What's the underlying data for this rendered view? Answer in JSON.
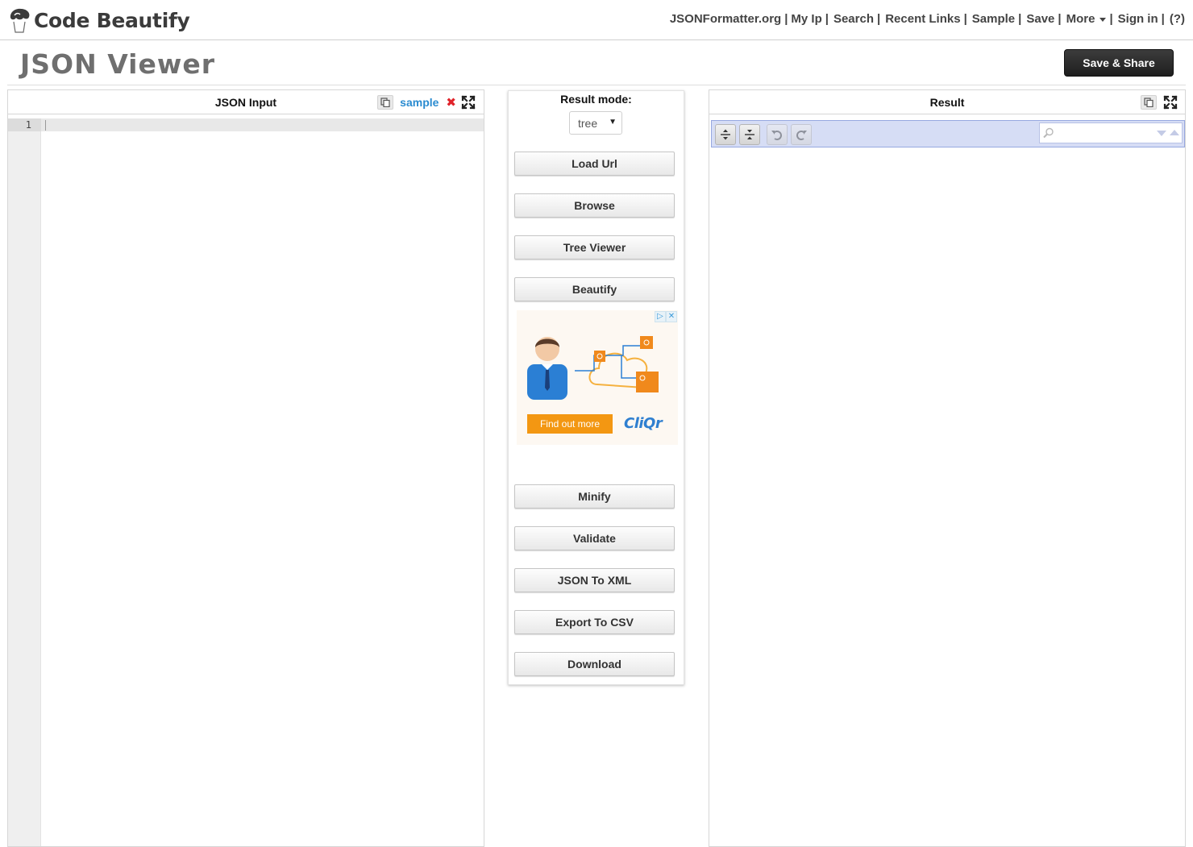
{
  "brand": {
    "name": "Code Beautify"
  },
  "nav": {
    "items": [
      {
        "label": "JSONFormatter.org"
      },
      {
        "label": "My Ip"
      },
      {
        "label": "Search"
      },
      {
        "label": "Recent Links"
      },
      {
        "label": "Sample"
      },
      {
        "label": "Save"
      },
      {
        "label": "More"
      },
      {
        "label": "Sign in"
      },
      {
        "label": "(?)"
      }
    ],
    "separator": "|"
  },
  "page": {
    "title": "JSON Viewer",
    "save_share_label": "Save & Share"
  },
  "input_panel": {
    "title": "JSON Input",
    "sample_label": "sample",
    "clear_glyph": "✖",
    "line_numbers": [
      "1"
    ],
    "content": ""
  },
  "controls": {
    "result_mode_label": "Result mode:",
    "result_mode_value": "tree",
    "buttons": [
      {
        "label": "Load Url"
      },
      {
        "label": "Browse"
      },
      {
        "label": "Tree Viewer"
      },
      {
        "label": "Beautify"
      },
      {
        "label": "Minify"
      },
      {
        "label": "Validate"
      },
      {
        "label": "JSON To XML"
      },
      {
        "label": "Export To CSV"
      },
      {
        "label": "Download"
      }
    ]
  },
  "ad": {
    "cta_label": "Find out more",
    "brand": "CliQr",
    "badge_play": "▷",
    "badge_close": "✕"
  },
  "result_panel": {
    "title": "Result",
    "search": {
      "placeholder": "",
      "value": ""
    }
  },
  "colors": {
    "link_blue": "#2a8bd0",
    "clear_red": "#e0232a",
    "toolbar_bg": "#d6ddf5",
    "ad_orange": "#f39712",
    "ad_brand_blue": "#2f7fd0"
  },
  "icons": {
    "brand_logo": "chef-hat-logo",
    "copy": "copy-icon",
    "clear": "close-x-icon",
    "expand": "fullscreen-expand-icon",
    "expand_all": "expand-all-icon",
    "collapse_all": "collapse-all-icon",
    "undo": "undo-icon",
    "redo": "redo-icon",
    "search": "search-icon",
    "next": "chevron-down-icon",
    "prev": "chevron-up-icon"
  }
}
